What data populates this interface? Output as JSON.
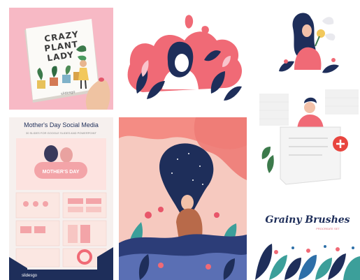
{
  "gallery": {
    "book": {
      "line1": "CRAZY",
      "line2": "PLANT",
      "line3": "LADY",
      "publisher": "slidesgo"
    },
    "template": {
      "title": "Mother's Day Social Media",
      "subtitle": "30 SLIDES FOR GOOGLE SLIDES AND POWERPOINT",
      "hero": "MOTHER'S DAY",
      "brand": "slidesgo"
    },
    "brushes": {
      "title": "Grainy Brushes",
      "subtitle": "PROCREATE SET"
    }
  },
  "colors": {
    "pink_bg": "#f7b9c5",
    "coral": "#f06a76",
    "navy": "#1e2e5a",
    "peach": "#f6c9bf",
    "teal": "#3c9f9a"
  }
}
